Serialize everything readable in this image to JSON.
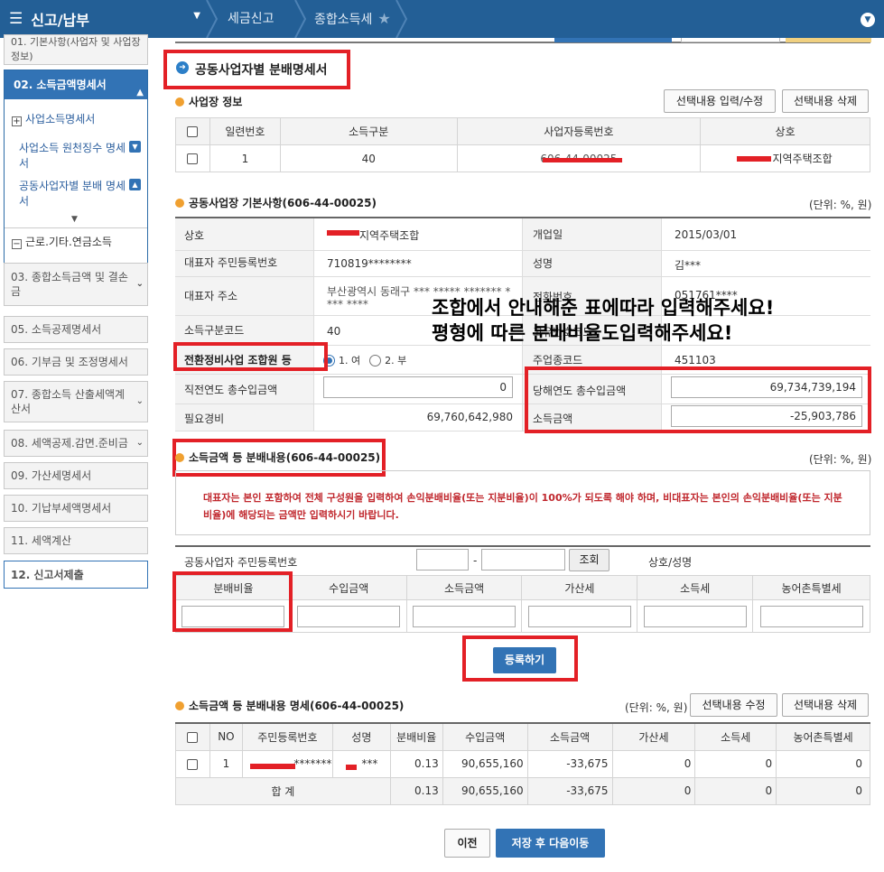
{
  "topbar": {
    "menu_label": "신고/납부",
    "crumb1": "세금신고",
    "crumb2": "종합소득세"
  },
  "sidebar": {
    "item01": "01. 기본사항(사업자 및 사업장정보)",
    "item02": "02. 소득금액명세서",
    "sub_business_income": "사업소득명세서",
    "sub_withholding": "사업소득 원천징수 명세서",
    "sub_partner": "공동사업자별 분배 명세서",
    "sub_labor": "근로.기타.연금소득",
    "item03": "03. 종합소득금액 및 결손금",
    "item05": "05. 소득공제명세서",
    "item06": "06. 기부금 및 조정명세서",
    "item07": "07. 종합소득 산출세액계산서",
    "item08": "08. 세액공제.감면.준비금",
    "item09": "09. 가산세명세서",
    "item10": "10. 기납부세액명세서",
    "item11": "11. 세액계산",
    "item12": "12. 신고서제출"
  },
  "page_title": "공동사업자별 분배명세서",
  "business": {
    "section": "사업장 정보",
    "btn_edit": "선택내용 입력/수정",
    "btn_delete": "선택내용 삭제",
    "headers": [
      "일련번호",
      "소득구분",
      "사업자등록번호",
      "상호"
    ],
    "row": {
      "serial": "1",
      "income_type": "40",
      "reg_no": "606-44-00025",
      "name_suffix": "지역주택조합"
    }
  },
  "basic": {
    "section": "공동사업장 기본사항(606-44-00025)",
    "unit": "(단위: %, 원)",
    "l_name": "상호",
    "v_name_suffix": "지역주택조합",
    "l_open": "개업일",
    "v_open": "2015/03/01",
    "l_rep_id": "대표자 주민등록번호",
    "v_rep_id": "710819********",
    "l_rep_name": "성명",
    "v_rep_name": "김***",
    "l_addr": "대표자 주소",
    "v_addr1": "부산광역시 동래구 *** ***** ******* *",
    "v_addr2": "*** ****",
    "l_phone": "전화번호",
    "v_phone": "051761****",
    "l_code": "소득구분코드",
    "v_code": "40",
    "l_biz_code": "고유번호코드",
    "l_member": "전환정비사업 조합원 등",
    "opt_yes": "1. 여",
    "opt_no": "2. 부",
    "l_main": "주업종코드",
    "v_main": "451103",
    "l_prev": "직전연도 총수입금액",
    "v_prev": "0",
    "l_cur": "당해연도 총수입금액",
    "v_cur": "69,734,739,194",
    "l_exp": "필요경비",
    "v_exp": "69,760,642,980",
    "l_income": "소득금액",
    "v_income": "-25,903,786"
  },
  "overlay": {
    "line1": "조합에서 안내해준 표에따라 입력해주세요!",
    "line2": "평형에 따른 분배비율도입력해주세요!"
  },
  "distribution": {
    "section": "소득금액 등 분배내용(606-44-00025)",
    "unit": "(단위: %, 원)",
    "notice": "대표자는 본인 포함하여 전체 구성원을 입력하여 손익분배비율(또는 지분비율)이 100%가 되도록 해야 하며, 비대표자는 본인의 손익분배비율(또는 지분비율)에 해당되는 금액만 입력하시기 바랍니다.",
    "l_partner_id": "공동사업자 주민등록번호",
    "dash": "-",
    "btn_lookup": "조회",
    "l_name": "상호/성명",
    "headers": [
      "분배비율",
      "수입금액",
      "소득금액",
      "가산세",
      "소득세",
      "농어촌특별세"
    ],
    "btn_register": "등록하기"
  },
  "detail": {
    "section": "소득금액 등 분배내용 명세(606-44-00025)",
    "unit": "(단위: %, 원)",
    "btn_edit": "선택내용 수정",
    "btn_delete": "선택내용 삭제",
    "headers": [
      "NO",
      "주민등록번호",
      "성명",
      "분배비율",
      "수입금액",
      "소득금액",
      "가산세",
      "소득세",
      "농어촌특별세"
    ],
    "row": {
      "no": "1",
      "id_suffix": "*******",
      "name_suffix": "***",
      "ratio": "0.13",
      "revenue": "90,655,160",
      "income": "-33,675",
      "add_tax": "0",
      "income_tax": "0",
      "rural_tax": "0"
    },
    "total": {
      "label": "합 계",
      "ratio": "0.13",
      "revenue": "90,655,160",
      "income": "-33,675",
      "add_tax": "0",
      "income_tax": "0",
      "rural_tax": "0"
    }
  },
  "footer": {
    "btn_prev": "이전",
    "btn_save": "저장 후 다음이동"
  }
}
